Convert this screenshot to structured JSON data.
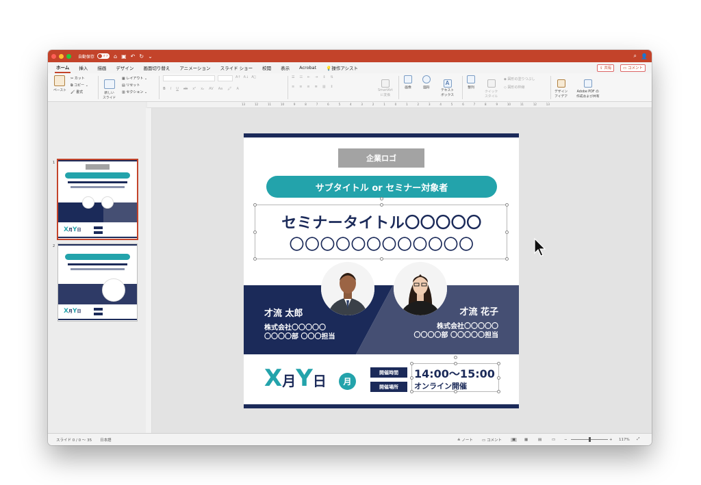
{
  "titlebar": {
    "autosave_label": "自動保存",
    "autosave_state": "オフ",
    "colors": {
      "brand": "#c3432a"
    }
  },
  "ribbon_tabs": [
    "ホーム",
    "挿入",
    "描画",
    "デザイン",
    "画面切り替え",
    "アニメーション",
    "スライド ショー",
    "校閲",
    "表示",
    "Acrobat"
  ],
  "tell_me": "操作アシスト",
  "share_button": "共有",
  "comments_button": "コメント",
  "ribbon": {
    "paste": "ペースト",
    "cut": "カット",
    "copy": "コピー",
    "format": "書式",
    "new_slide": "新しい\nスライド",
    "layout": "レイアウト",
    "reset": "リセット",
    "section": "セクション",
    "smartart": "SmartArt\nに変換",
    "picture": "画像",
    "shapes": "図形",
    "textbox": "テキスト\nボックス",
    "arrange": "整列",
    "quick_styles": "クイック\nスタイル",
    "shape_fill": "図形の塗りつぶし",
    "shape_outline": "図形の枠線",
    "design_ideas": "デザイン\nアイデア",
    "adobe_pdf": "Adobe PDF の\n作成および共有"
  },
  "ruler_ticks": [
    "13",
    "12",
    "11",
    "10",
    "9",
    "8",
    "7",
    "6",
    "5",
    "4",
    "3",
    "2",
    "1",
    "0",
    "1",
    "2",
    "3",
    "4",
    "5",
    "6",
    "7",
    "8",
    "9",
    "10",
    "11",
    "12",
    "13"
  ],
  "thumbnails": [
    {
      "number": "1",
      "selected": true
    },
    {
      "number": "2",
      "selected": false
    }
  ],
  "slide": {
    "logo": "企業ロゴ",
    "subtitle": "サブタイトル or セミナー対象者",
    "title_line1": "セミナータイトル〇〇〇〇〇",
    "title_line2": "〇〇〇〇〇〇〇〇〇〇〇〇",
    "speaker1_name": "才流 太郎",
    "speaker1_company": "株式会社〇〇〇〇〇",
    "speaker1_dept": "〇〇〇〇部 〇〇〇担当",
    "speaker2_name": "才流 花子",
    "speaker2_company": "株式会社〇〇〇〇〇",
    "speaker2_dept": "〇〇〇〇部 〇〇〇〇〇担当",
    "date_x": "X",
    "date_month": "月",
    "date_y": "Y",
    "date_day": "日",
    "weekday": "月",
    "time_label": "開催時間",
    "time_value": "14:00〜15:00",
    "place_label": "開催場所",
    "place_value": "オンライン開催",
    "colors": {
      "navy": "#1b2a59",
      "teal": "#23a3ab",
      "slate": "#454f73",
      "gray": "#a3a3a3"
    }
  },
  "thumb2": {
    "subtitle": "サブタイトル or セミナー対象者",
    "title_line1": "セミナータイトル〇〇〇〇〇",
    "title_line2": "〇〇〇〇〇〇〇〇〇〇〇〇",
    "speaker_name": "才流 太郎"
  },
  "status": {
    "slide_counter": "スライド 0 / 0 〜 35",
    "language": "日本語",
    "notes": "ノート",
    "comments": "コメント",
    "zoom": "117%"
  }
}
